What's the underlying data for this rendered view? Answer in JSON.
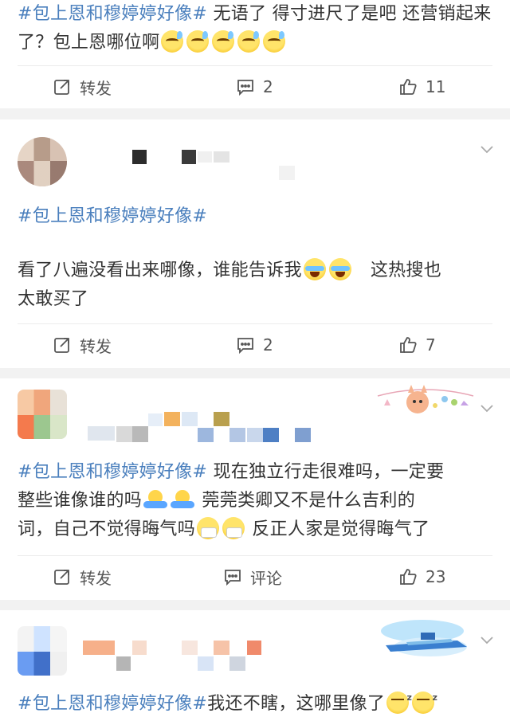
{
  "posts": [
    {
      "hashtag": "#包上恩和穆婷婷好像#",
      "text": " 无语了 得寸进尺了是吧 还营销起来了？包上恩哪位啊",
      "emoji": "sweat-smile",
      "actions": {
        "forward": "转发",
        "comment": "2",
        "like": "11"
      }
    },
    {
      "hashtag": "#包上恩和穆婷婷好像#",
      "text_line1": "看了八遍没看出来哪像，谁能告诉我",
      "text_line1b": "这热搜也",
      "text_line2": "太敢买了",
      "emoji": "laugh-cry",
      "actions": {
        "forward": "转发",
        "comment": "2",
        "like": "7"
      }
    },
    {
      "hashtag": "#包上恩和穆婷婷好像#",
      "text_a": " 现在独立行走很难吗，一定要",
      "text_b": "整些谁像谁的吗",
      "text_c": " 莞莞类卿又不是什么吉利的",
      "text_d": "词，自己不觉得晦气吗",
      "text_e": " 反正人家是觉得晦气了",
      "emoji": "hug",
      "emoji2": "mask",
      "actions": {
        "forward": "转发",
        "comment": "评论",
        "like": "23"
      }
    },
    {
      "hashtag": "#包上恩和穆婷婷好像#",
      "text": "我还不瞎，这哪里像了",
      "emoji": "smirk"
    }
  ],
  "icons": {
    "forward": "forward-icon",
    "comment": "comment-icon",
    "like": "like-icon",
    "more": "chevron-down-icon"
  },
  "colors": {
    "hashtag": "#4a7fbd",
    "text": "#333333",
    "divider": "#ececec",
    "background": "#f2f2f2"
  }
}
